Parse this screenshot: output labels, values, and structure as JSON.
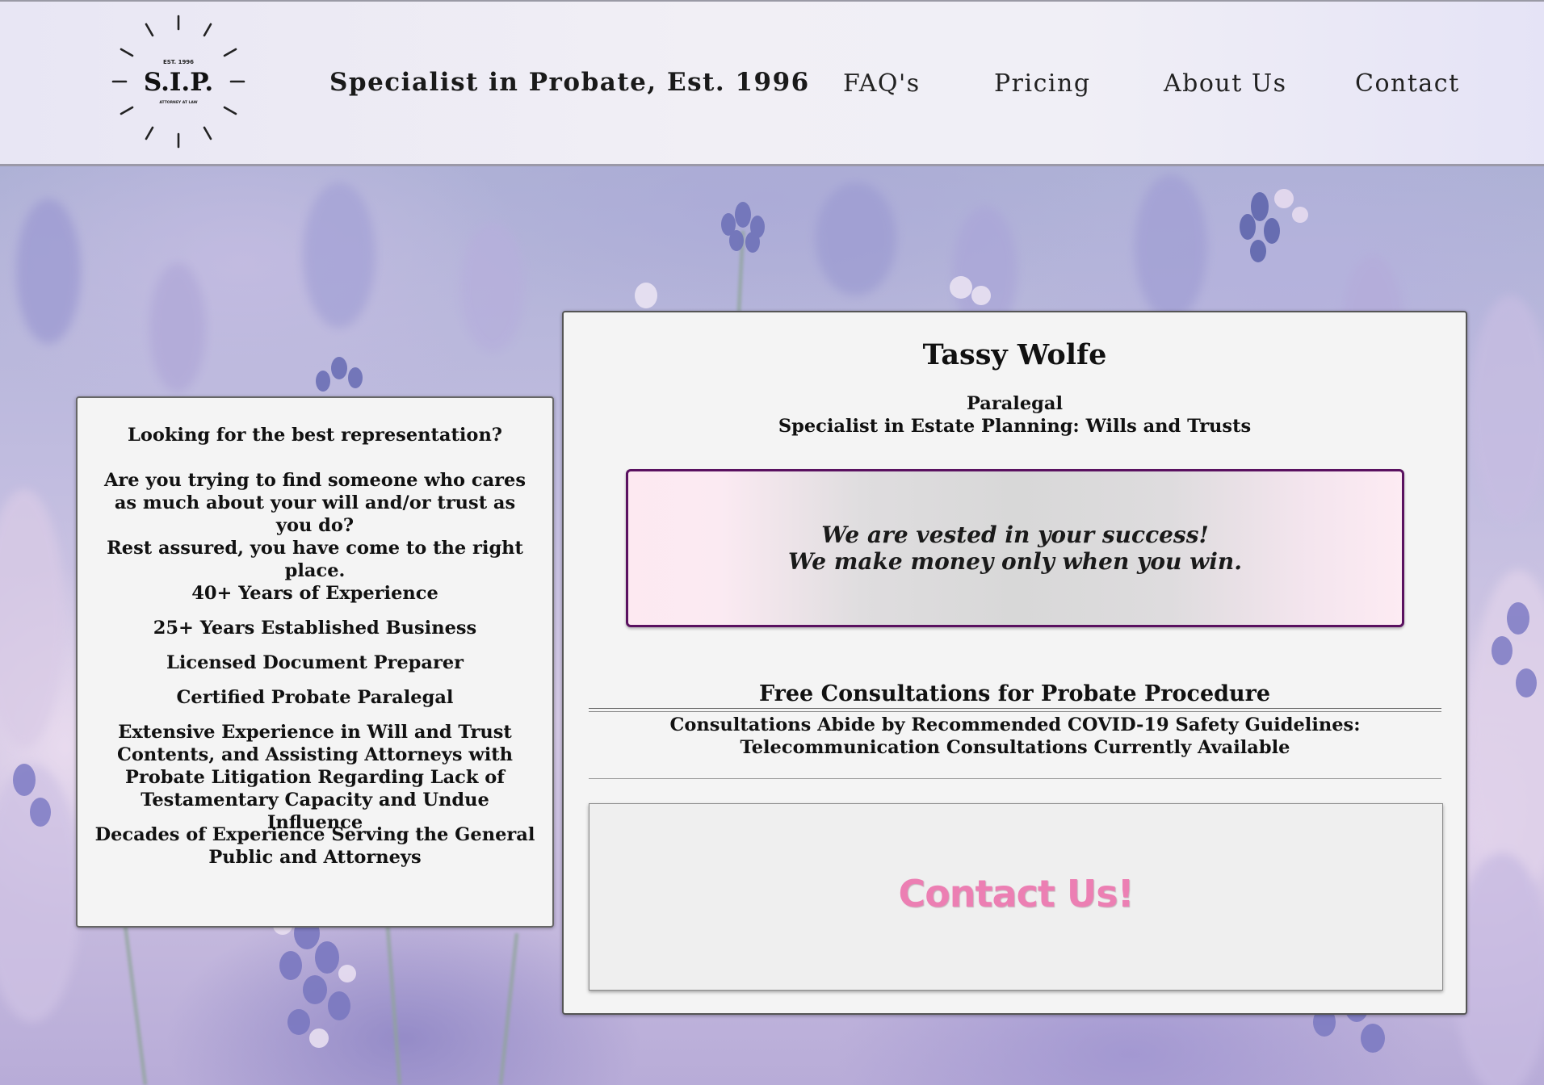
{
  "header": {
    "logo": {
      "est": "EST. 1996",
      "mark": "S.I.P.",
      "sub": "ATTORNEY AT LAW"
    },
    "tagline": "Specialist in Probate, Est. 1996",
    "nav": [
      "FAQ's",
      "Pricing",
      "About Us",
      "Contact"
    ]
  },
  "left_card": {
    "intro": "Looking for the best representation?",
    "question": "Are you trying to find someone who cares as much about your will and/or trust as you do?",
    "assurance": "Rest assured, you have come to the right place.",
    "points": [
      "40+ Years of Experience",
      "25+ Years Established Business",
      "Licensed Document Preparer",
      "Certified Probate Paralegal",
      "Extensive Experience in Will and Trust Contents, and Assisting Attorneys with Probate Litigation Regarding Lack of Testamentary Capacity and Undue Influence",
      "Decades of Experience Serving the General Public and Attorneys"
    ]
  },
  "right_card": {
    "name": "Tassy Wolfe",
    "role": "Paralegal",
    "specialty": "Specialist in Estate Planning: Wills and Trusts",
    "quote": [
      "We are vested in your success!",
      "We make money only when you win."
    ],
    "consult_title": "Free Consultations for Probate Procedure",
    "consult_note": "Consultations Abide by Recommended COVID-19 Safety Guidelines: Telecommunication Consultations Currently Available",
    "contact_cta": "Contact Us!"
  },
  "colors": {
    "cta_pink": "#ec7fb3",
    "quote_border": "#5a1160",
    "header_bg": "#efeef5"
  }
}
